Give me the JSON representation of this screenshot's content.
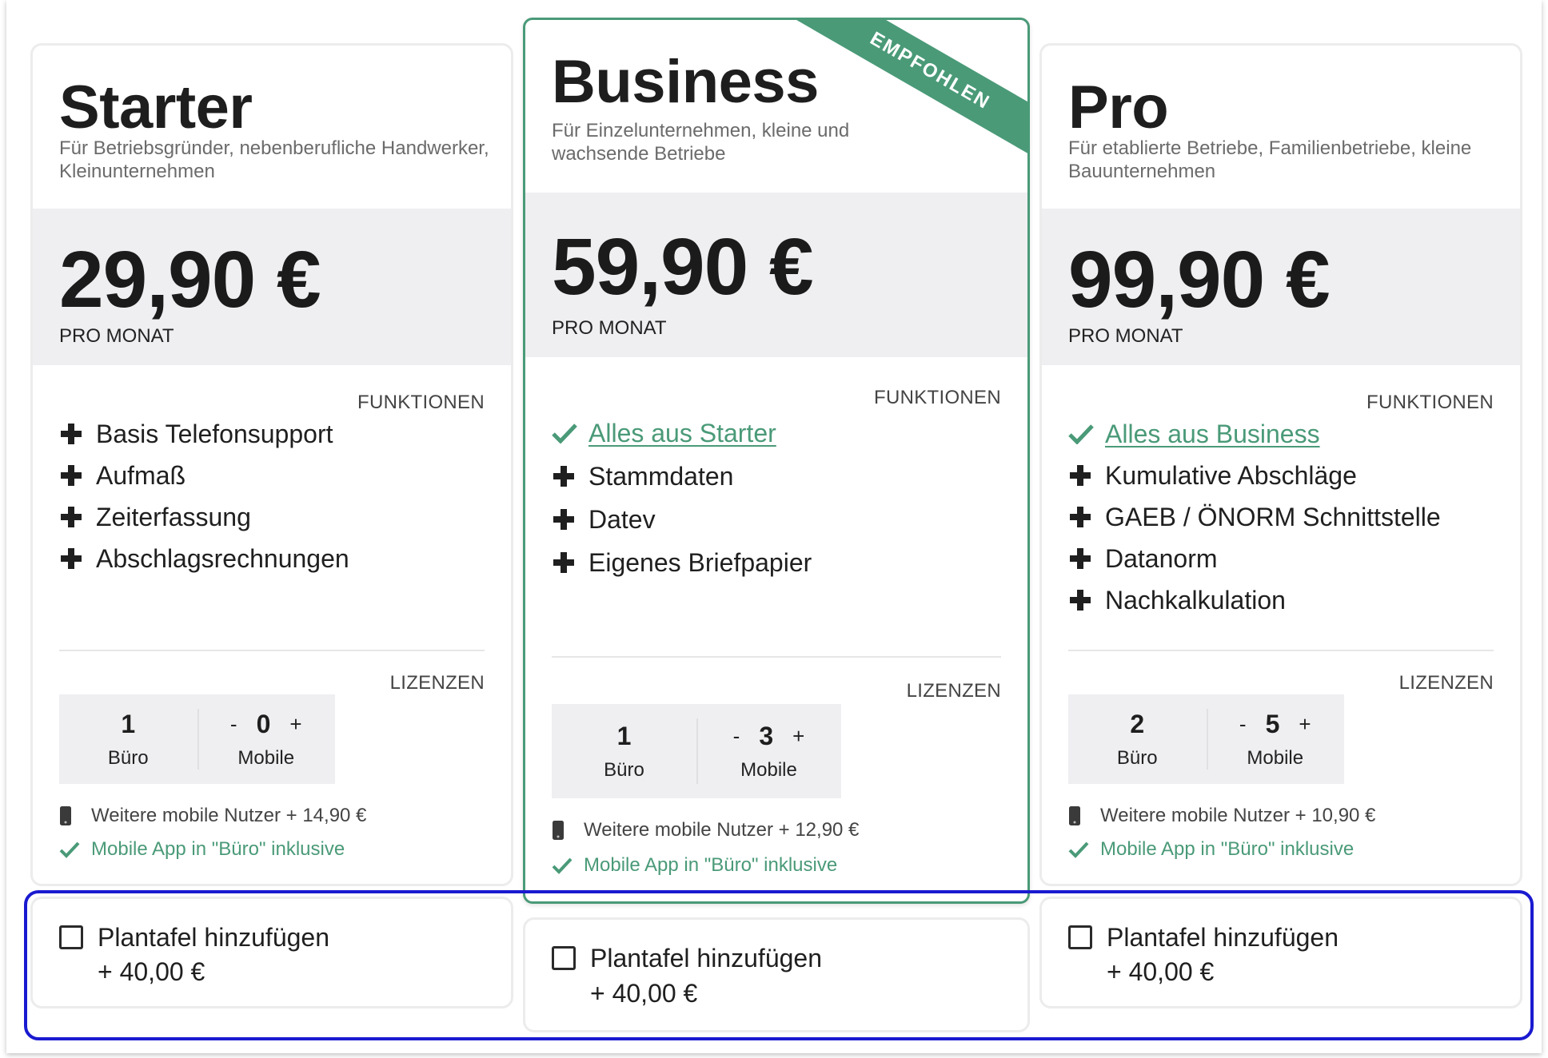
{
  "accent_color": "#4a9a78",
  "highlight_color": "#1a1ad0",
  "plans": [
    {
      "name": "Starter",
      "description": "Für Betriebsgründer, nebenberufliche Handwerker, Kleinunternehmen",
      "price": "29,90 €",
      "period": "PRO MONAT",
      "features_label": "FUNKTIONEN",
      "features": [
        "Basis Telefonsupport",
        "Aufmaß",
        "Zeiterfassung",
        "Abschlagsrechnungen"
      ],
      "licenses_label": "LIZENZEN",
      "office_count": "1",
      "office_label": "Büro",
      "mobile_count": "0",
      "mobile_label": "Mobile",
      "minus": "-",
      "plus": "+",
      "extra_users": "Weitere mobile Nutzer + 14,90 €",
      "mobile_included": "Mobile App in \"Büro\" inklusive"
    },
    {
      "name": "Business",
      "badge": "EMPFOHLEN",
      "description": "Für Einzelunternehmen, kleine und wachsende Betriebe",
      "price": "59,90 €",
      "period": "PRO MONAT",
      "features_label": "FUNKTIONEN",
      "includes_link": "Alles aus Starter",
      "features": [
        "Stammdaten",
        "Datev",
        "Eigenes Briefpapier"
      ],
      "licenses_label": "LIZENZEN",
      "office_count": "1",
      "office_label": "Büro",
      "mobile_count": "3",
      "mobile_label": "Mobile",
      "minus": "-",
      "plus": "+",
      "extra_users": "Weitere mobile Nutzer + 12,90 €",
      "mobile_included": "Mobile App in \"Büro\" inklusive"
    },
    {
      "name": "Pro",
      "description": "Für etablierte Betriebe, Familienbetriebe, kleine Bauunternehmen",
      "price": "99,90 €",
      "period": "PRO MONAT",
      "features_label": "FUNKTIONEN",
      "includes_link": "Alles aus Business",
      "features": [
        "Kumulative Abschläge",
        "GAEB / ÖNORM Schnittstelle",
        "Datanorm",
        "Nachkalkulation"
      ],
      "licenses_label": "LIZENZEN",
      "office_count": "2",
      "office_label": "Büro",
      "mobile_count": "5",
      "mobile_label": "Mobile",
      "minus": "-",
      "plus": "+",
      "extra_users": "Weitere mobile Nutzer + 10,90 €",
      "mobile_included": "Mobile App in \"Büro\" inklusive"
    }
  ],
  "addons": [
    {
      "label": "Plantafel hinzufügen",
      "price": "+ 40,00 €",
      "checked": false
    },
    {
      "label": "Plantafel hinzufügen",
      "price": "+ 40,00 €",
      "checked": false
    },
    {
      "label": "Plantafel hinzufügen",
      "price": "+ 40,00 €",
      "checked": false
    }
  ]
}
